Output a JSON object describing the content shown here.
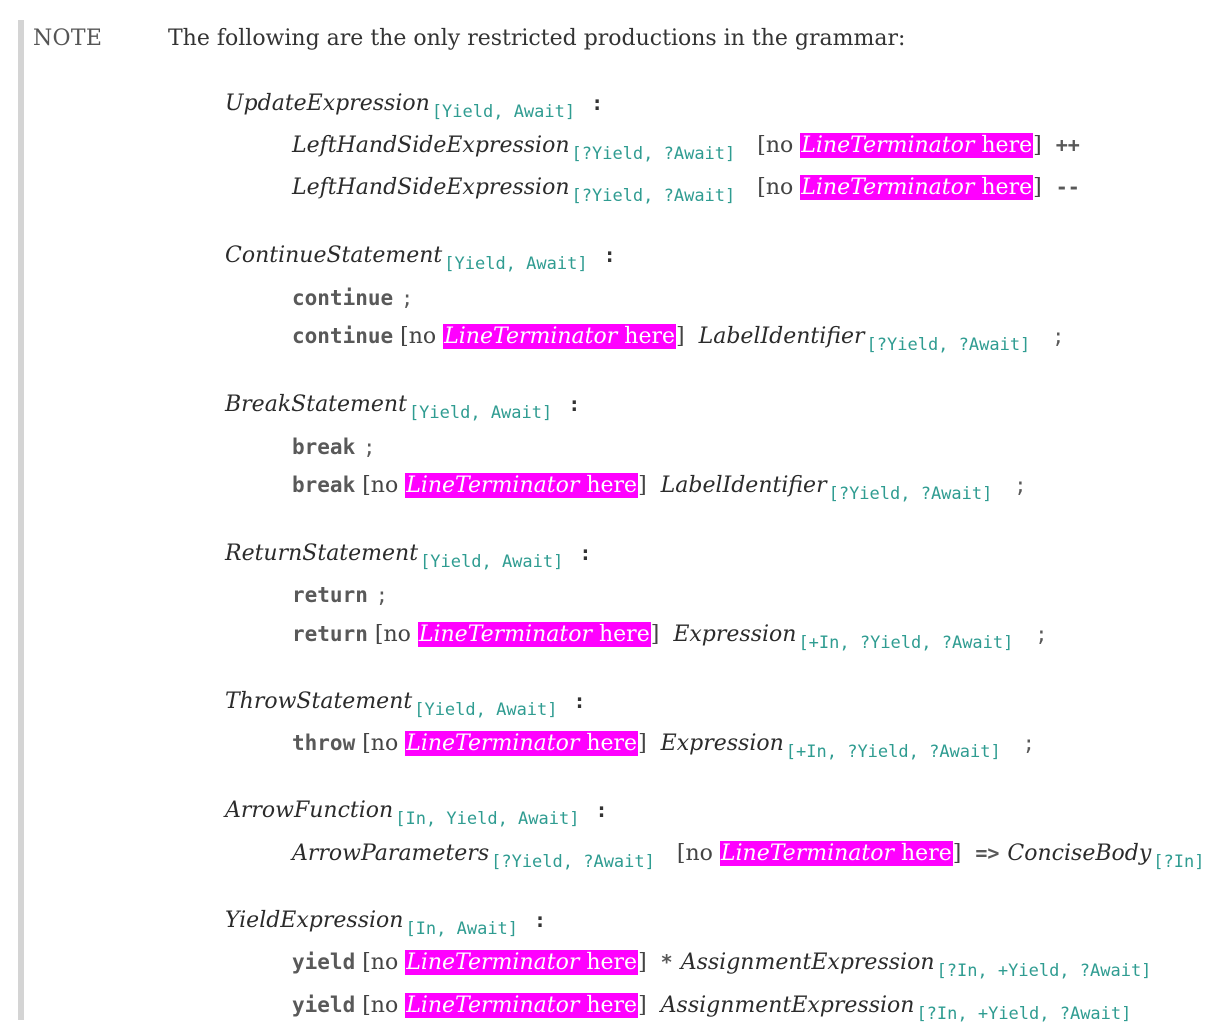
{
  "note": {
    "label": "NOTE",
    "intro": "The following are the only restricted productions in the grammar:"
  },
  "restriction": {
    "open": "[no",
    "nonterminal": "LineTerminator",
    "here": "here",
    "close": "]"
  },
  "colon": ":",
  "productions": [
    {
      "lhs": "UpdateExpression",
      "lhs_params": "[Yield, Await]",
      "rhs": [
        {
          "nt": "LeftHandSideExpression",
          "params": "[?Yield, ?Await]",
          "op": "++"
        },
        {
          "nt": "LeftHandSideExpression",
          "params": "[?Yield, ?Await]",
          "op": "--"
        }
      ]
    },
    {
      "lhs": "ContinueStatement",
      "lhs_params": "[Yield, Await]",
      "rhs": [
        {
          "kw": "continue",
          "semi": ";"
        },
        {
          "kw": "continue",
          "nt": "LabelIdentifier",
          "params": "[?Yield, ?Await]",
          "semi": ";"
        }
      ]
    },
    {
      "lhs": "BreakStatement",
      "lhs_params": "[Yield, Await]",
      "rhs": [
        {
          "kw": "break",
          "semi": ";"
        },
        {
          "kw": "break",
          "nt": "LabelIdentifier",
          "params": "[?Yield, ?Await]",
          "semi": ";"
        }
      ]
    },
    {
      "lhs": "ReturnStatement",
      "lhs_params": "[Yield, Await]",
      "rhs": [
        {
          "kw": "return",
          "semi": ";"
        },
        {
          "kw": "return",
          "nt": "Expression",
          "params": "[+In, ?Yield, ?Await]",
          "semi": ";"
        }
      ]
    },
    {
      "lhs": "ThrowStatement",
      "lhs_params": "[Yield, Await]",
      "rhs": [
        {
          "kw": "throw",
          "nt": "Expression",
          "params": "[+In, ?Yield, ?Await]",
          "semi": ";"
        }
      ]
    },
    {
      "lhs": "ArrowFunction",
      "lhs_params": "[In, Yield, Await]",
      "rhs": [
        {
          "nt": "ArrowParameters",
          "params": "[?Yield, ?Await]",
          "op": "=>",
          "nt2": "ConciseBody",
          "params2": "[?In]"
        }
      ]
    },
    {
      "lhs": "YieldExpression",
      "lhs_params": "[In, Await]",
      "rhs": [
        {
          "kw": "yield",
          "op": "*",
          "nt": "AssignmentExpression",
          "params": "[?In, +Yield, ?Await]"
        },
        {
          "kw": "yield",
          "nt": "AssignmentExpression",
          "params": "[?In, +Yield, ?Await]"
        }
      ]
    }
  ],
  "colors": {
    "highlight": "#ff00ff",
    "params": "#2f9c91",
    "note_bar": "#d4d4d4"
  }
}
